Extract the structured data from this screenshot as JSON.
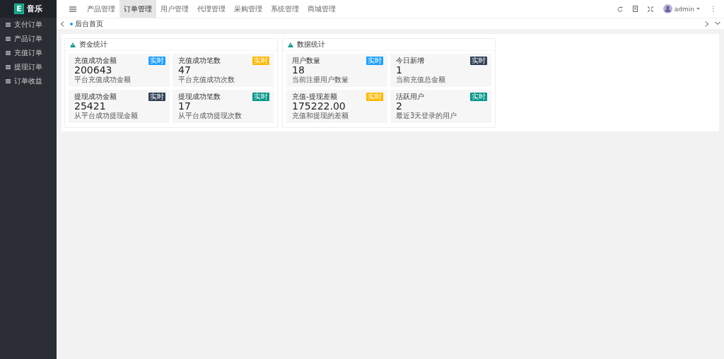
{
  "logo": {
    "mark": "E",
    "title": "音乐"
  },
  "sidebar": {
    "items": [
      {
        "label": "支付订单",
        "selected": false
      },
      {
        "label": "产品订单",
        "selected": false
      },
      {
        "label": "充值订单",
        "selected": false
      },
      {
        "label": "提现订单",
        "selected": false
      },
      {
        "label": "订单收益",
        "selected": false
      }
    ]
  },
  "top_nav": [
    {
      "label": "产品管理",
      "selected": false
    },
    {
      "label": "订单管理",
      "selected": true
    },
    {
      "label": "用户管理",
      "selected": false
    },
    {
      "label": "代理管理",
      "selected": false
    },
    {
      "label": "采购管理",
      "selected": false
    },
    {
      "label": "系统管理",
      "selected": false
    },
    {
      "label": "商城管理",
      "selected": false
    }
  ],
  "user": {
    "name": "admin",
    "more": "⋮"
  },
  "tabs": [
    {
      "label": "后台首页",
      "selected": true
    }
  ],
  "panels": [
    {
      "title": "资金统计",
      "stats": [
        {
          "label": "充值成功金额",
          "value": "200643",
          "note": "平台充值成功金额",
          "badge": "实时",
          "color": "#1e9fff"
        },
        {
          "label": "充值成功笔数",
          "value": "47",
          "note": "平台充值成功次数",
          "badge": "实时",
          "color": "#ffb800"
        },
        {
          "label": "提现成功金额",
          "value": "25421",
          "note": "从平台成功提现金额",
          "badge": "实时",
          "color": "#2f4056"
        },
        {
          "label": "提现成功笔数",
          "value": "17",
          "note": "从平台成功提现次数",
          "badge": "实时",
          "color": "#009688"
        }
      ]
    },
    {
      "title": "数据统计",
      "stats": [
        {
          "label": "用户数量",
          "value": "18",
          "note": "当前注册用户数量",
          "badge": "实时",
          "color": "#1e9fff"
        },
        {
          "label": "今日新增",
          "value": "1",
          "note": "当前充值总金额",
          "badge": "实时",
          "color": "#2f4056"
        },
        {
          "label": "充值-提现差额",
          "value": "175222.00",
          "note": "充值和提现的差额",
          "badge": "实时",
          "color": "#ffb800"
        },
        {
          "label": "活跃用户",
          "value": "2",
          "note": "最近3天登录的用户",
          "badge": "实时",
          "color": "#009688"
        }
      ]
    }
  ]
}
